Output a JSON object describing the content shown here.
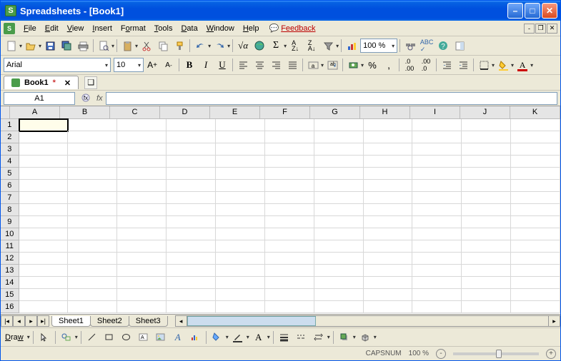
{
  "titlebar": {
    "app_icon_letter": "S",
    "title": "Spreadsheets - [Book1]"
  },
  "menu": {
    "items": [
      "File",
      "Edit",
      "View",
      "Insert",
      "Format",
      "Tools",
      "Data",
      "Window",
      "Help"
    ],
    "feedback": "Feedback"
  },
  "toolbar1": {
    "zoom": "100 %"
  },
  "toolbar2": {
    "font": "Arial",
    "size": "10"
  },
  "doc_tab": {
    "name": "Book1"
  },
  "formula": {
    "cell_ref": "A1",
    "fx_label": "fx"
  },
  "grid": {
    "columns": [
      "A",
      "B",
      "C",
      "D",
      "E",
      "F",
      "G",
      "H",
      "I",
      "J",
      "K"
    ],
    "rows": [
      "1",
      "2",
      "3",
      "4",
      "5",
      "6",
      "7",
      "8",
      "9",
      "10",
      "11",
      "12",
      "13",
      "14",
      "15",
      "16"
    ],
    "active": "A1"
  },
  "sheets": {
    "tabs": [
      "Sheet1",
      "Sheet2",
      "Sheet3"
    ],
    "active": 0
  },
  "draw": {
    "label": "Draw"
  },
  "status": {
    "caps": "CAPSNUM",
    "zoom": "100 %"
  }
}
